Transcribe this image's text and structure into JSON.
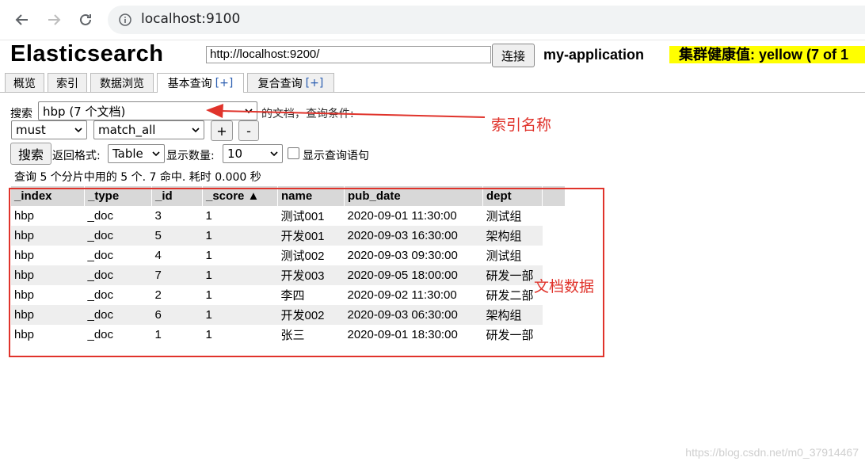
{
  "browser": {
    "url": "localhost:9100"
  },
  "app": {
    "title": "Elasticsearch",
    "es_url": "http://localhost:9200/",
    "connect_label": "连接",
    "cluster_name": "my-application",
    "health": "集群健康值: yellow (7 of 1"
  },
  "tabs": [
    {
      "label": "概览",
      "plus": ""
    },
    {
      "label": "索引",
      "plus": ""
    },
    {
      "label": "数据浏览",
      "plus": ""
    },
    {
      "label": "基本查询",
      "plus": "[+]"
    },
    {
      "label": "复合查询",
      "plus": "[+]"
    }
  ],
  "query": {
    "search_label": "搜索",
    "index_select": "hbp (7 个文档)",
    "after_select": "的文档，查询条件:",
    "must_select": "must",
    "match_select": "match_all",
    "plus_btn": "+",
    "minus_btn": "-",
    "search_btn": "搜索",
    "format_label": "返回格式:",
    "format_select": "Table",
    "size_label": "显示数量:",
    "size_select": "10",
    "show_query_label": "显示查询语句",
    "status": "查询 5 个分片中用的 5 个. 7 命中. 耗时 0.000 秒"
  },
  "annotations": {
    "index_name": "索引名称",
    "doc_data": "文档数据"
  },
  "table": {
    "headers": [
      "_index",
      "_type",
      "_id",
      "_score ▲",
      "name",
      "pub_date",
      "dept"
    ],
    "rows": [
      [
        "hbp",
        "_doc",
        "3",
        "1",
        "测试001",
        "2020-09-01 11:30:00",
        "测试组"
      ],
      [
        "hbp",
        "_doc",
        "5",
        "1",
        "开发001",
        "2020-09-03 16:30:00",
        "架构组"
      ],
      [
        "hbp",
        "_doc",
        "4",
        "1",
        "测试002",
        "2020-09-03 09:30:00",
        "测试组"
      ],
      [
        "hbp",
        "_doc",
        "7",
        "1",
        "开发003",
        "2020-09-05 18:00:00",
        "研发一部"
      ],
      [
        "hbp",
        "_doc",
        "2",
        "1",
        "李四",
        "2020-09-02 11:30:00",
        "研发二部"
      ],
      [
        "hbp",
        "_doc",
        "6",
        "1",
        "开发002",
        "2020-09-03 06:30:00",
        "架构组"
      ],
      [
        "hbp",
        "_doc",
        "1",
        "1",
        "张三",
        "2020-09-01 18:30:00",
        "研发一部"
      ]
    ]
  },
  "watermark": "https://blog.csdn.net/m0_37914467",
  "colors": {
    "annotation": "#e0332b",
    "health": "#ffff00"
  }
}
